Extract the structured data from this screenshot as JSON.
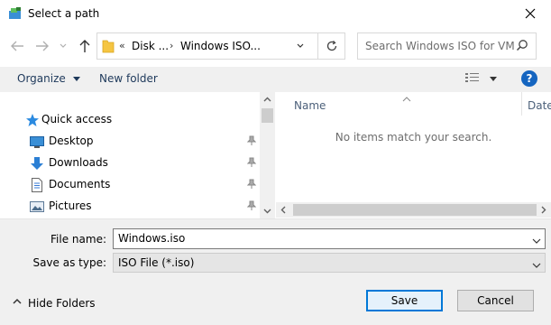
{
  "window": {
    "title": "Select a path"
  },
  "address": {
    "breadcrumbs": [
      "Disk ...",
      "Windows ISO..."
    ]
  },
  "search": {
    "placeholder": "Search Windows ISO for VM"
  },
  "toolbar": {
    "organize": "Organize",
    "new_folder": "New folder"
  },
  "sidebar": {
    "items": [
      {
        "label": "Quick access",
        "icon": "star-icon",
        "pinned": false
      },
      {
        "label": "Desktop",
        "icon": "desktop-icon",
        "pinned": true
      },
      {
        "label": "Downloads",
        "icon": "download-arrow-icon",
        "pinned": true
      },
      {
        "label": "Documents",
        "icon": "document-icon",
        "pinned": true
      },
      {
        "label": "Pictures",
        "icon": "pictures-icon",
        "pinned": true
      }
    ]
  },
  "content": {
    "columns": {
      "name": "Name",
      "date": "Date"
    },
    "empty_message": "No items match your search."
  },
  "form": {
    "file_name_label": "File name:",
    "file_name_value": "Windows.iso",
    "save_type_label": "Save as type:",
    "save_type_value": "ISO File (*.iso)"
  },
  "footer": {
    "hide_folders": "Hide Folders",
    "save": "Save",
    "cancel": "Cancel"
  },
  "colors": {
    "accent": "#0078d7",
    "folder": "#f5c542",
    "help": "#1565c0"
  }
}
